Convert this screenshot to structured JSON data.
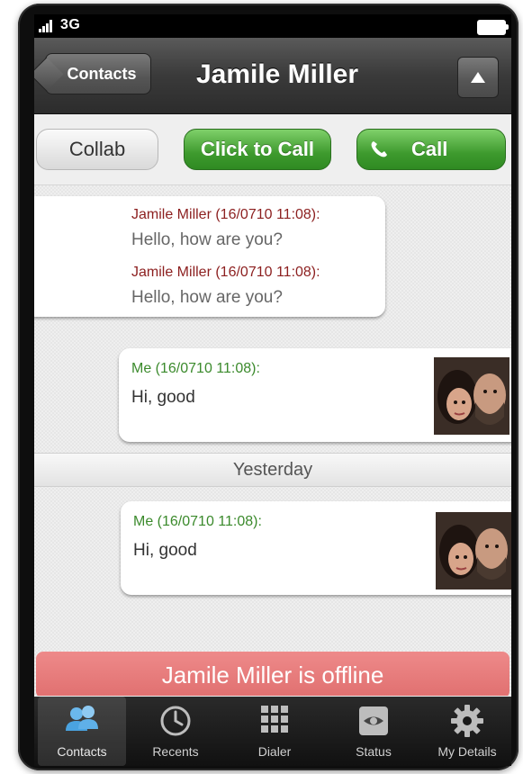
{
  "status_bar": {
    "network": "3G"
  },
  "nav": {
    "back_label": "Contacts",
    "title": "Jamile Miller"
  },
  "actions": {
    "collab": "Collab",
    "click_to_call": "Click to Call",
    "call": "Call"
  },
  "chat": {
    "incoming": [
      {
        "sender": "Jamile Miller (16/0710   11:08):",
        "text": "Hello, how are you?"
      },
      {
        "sender": "Jamile Miller (16/0710   11:08):",
        "text": "Hello, how are you?"
      }
    ],
    "outgoing": [
      {
        "sender": "Me (16/0710   11:08):",
        "text": "Hi, good"
      },
      {
        "sender": "Me (16/0710   11:08):",
        "text": "Hi, good"
      }
    ],
    "date_separator": "Yesterday",
    "offline_notice": "Jamile Miller is offline"
  },
  "tabs": [
    {
      "label": "Contacts",
      "icon": "contacts-icon",
      "active": true
    },
    {
      "label": "Recents",
      "icon": "clock-icon",
      "active": false
    },
    {
      "label": "Dialer",
      "icon": "keypad-icon",
      "active": false
    },
    {
      "label": "Status",
      "icon": "eye-icon",
      "active": false
    },
    {
      "label": "My Details",
      "icon": "gear-icon",
      "active": false
    }
  ],
  "colors": {
    "call_green": "#3e9a2e",
    "them_name": "#8c1f1f",
    "me_name": "#3b8a2c",
    "offline_red": "#e06f6f",
    "contacts_tab_blue": "#4aa3e0"
  }
}
